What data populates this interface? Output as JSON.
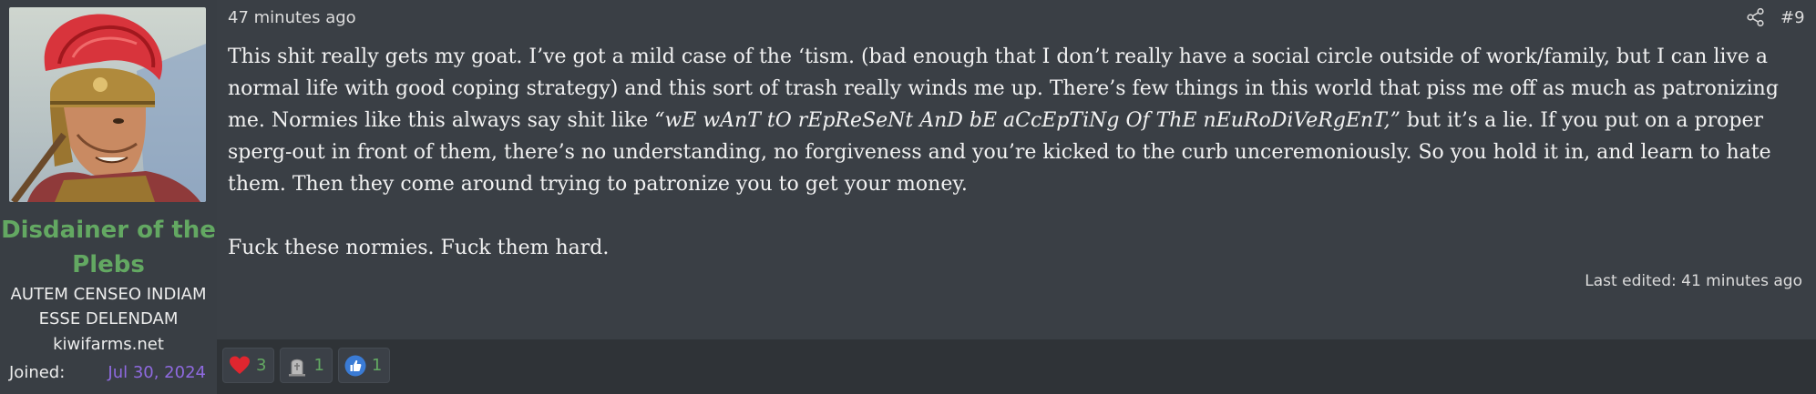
{
  "user": {
    "name": "Disdainer of the Plebs",
    "title": "AUTEM CENSEO INDIAM ESSE DELENDAM",
    "site": "kiwifarms.net",
    "joined_label": "Joined:",
    "joined_date": "Jul 30, 2024",
    "avatar_icon": "roman-soldier-avatar"
  },
  "post": {
    "timestamp": "47 minutes ago",
    "number": "#9",
    "share_icon": "share-icon",
    "paragraph1_a": "This shit really gets my goat. I’ve got a mild case of the ‘tism. (bad enough that I don’t really have a social circle outside of work/family, but I can live a normal life with good coping strategy) and this sort of trash really winds me up. There’s few things in this world that piss me off as much as patronizing me. Normies like this always say shit like ",
    "paragraph1_quote": "“wE wAnT tO rEpReSeNt AnD bE aCcEpTiNg Of ThE nEuRoDiVeRgEnT,”",
    "paragraph1_b": " but it’s a lie. If you put on a proper sperg-out in front of them, there’s no understanding, no forgiveness and you’re kicked to the curb unceremoniously. So you hold it in, and learn to hate them. Then they come around trying to patronize you to get your money.",
    "paragraph2": "Fuck these normies. Fuck them hard.",
    "last_edited": "Last edited: 41 minutes ago"
  },
  "reactions": [
    {
      "icon": "heart-icon",
      "count": "3"
    },
    {
      "icon": "tombstone-icon",
      "count": "1"
    },
    {
      "icon": "thumbs-up-icon",
      "count": "1"
    }
  ],
  "colors": {
    "username": "#63a862",
    "joined_date": "#8f6ae0",
    "reaction_count": "#63a862",
    "content_bg": "#3a3f45",
    "sidebar_bg": "#393e44"
  }
}
